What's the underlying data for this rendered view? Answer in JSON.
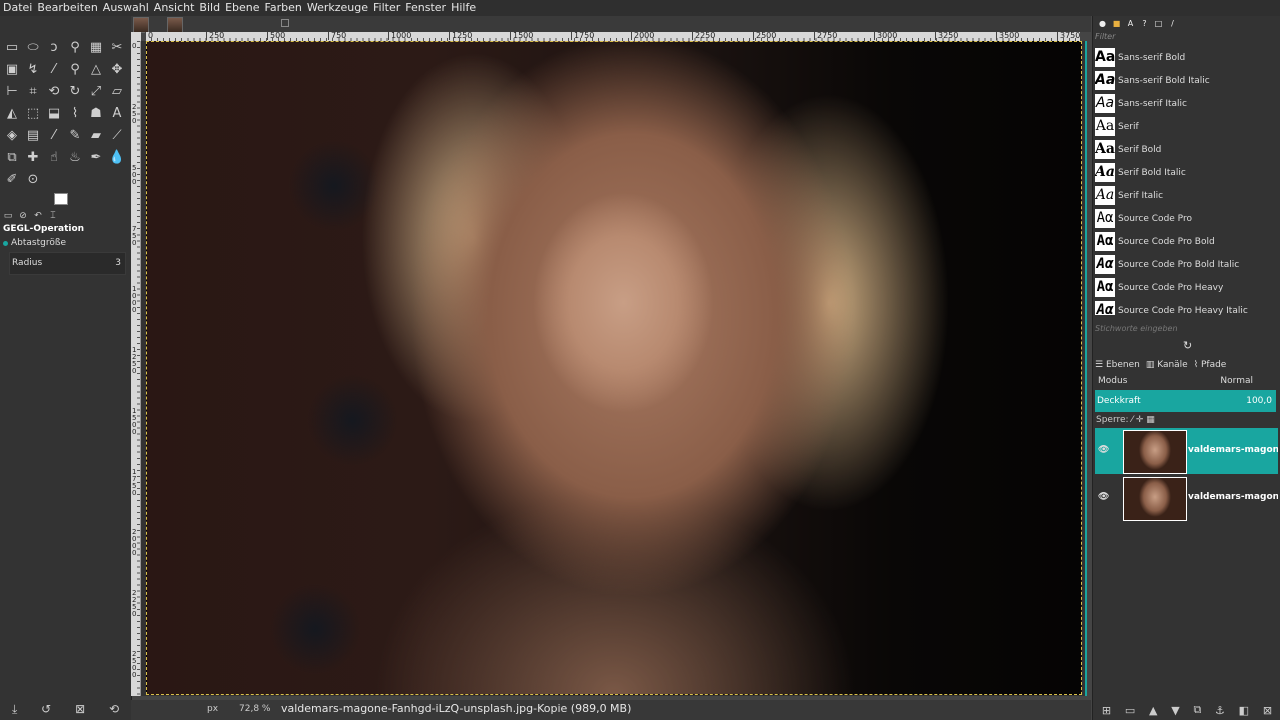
{
  "menu": [
    "Datei",
    "Bearbeiten",
    "Auswahl",
    "Ansicht",
    "Bild",
    "Ebene",
    "Farben",
    "Werkzeuge",
    "Filter",
    "Fenster",
    "Hilfe"
  ],
  "toolbox": {
    "tools": [
      "rect-select",
      "ellipse-select",
      "free-select",
      "fuzzy-select",
      "select-by-color",
      "scissors",
      "foreground-select",
      "paths",
      "color-picker",
      "zoom",
      "measure",
      "move",
      "align",
      "crop",
      "unified-transform",
      "rotate",
      "scale",
      "shear",
      "flip",
      "perspective",
      "3d-transform",
      "warp",
      "cage",
      "text",
      "bucket-fill",
      "gradient",
      "paintbrush",
      "pencil",
      "eraser",
      "airbrush",
      "clone",
      "heal",
      "smudge",
      "dodge",
      "ink",
      "blur",
      "mypaint-brush",
      "handle-transform"
    ],
    "options_title": "GEGL-Operation",
    "sample_size_label": "Abtastgröße",
    "radius_label": "Radius",
    "radius_value": "3"
  },
  "rulers": {
    "horizontal": [
      "0",
      "250",
      "500",
      "750",
      "1000",
      "1250",
      "1500",
      "1750",
      "2000",
      "2250",
      "2500",
      "2750",
      "3000",
      "3250",
      "3500",
      "3750"
    ],
    "vertical": [
      "0",
      "2 5 0",
      "5 0 0",
      "7 5 0",
      "1 0 0 0",
      "1 2 5 0",
      "1 5 0 0",
      "1 7 5 0",
      "2 0 0 0",
      "2 2 5 0",
      "2 5 0 0"
    ]
  },
  "statusbar": {
    "unit": "px",
    "zoom": "72,8 %",
    "title": "valdemars-magone-Fanhgd-iLzQ-unsplash.jpg-Kopie (989,0 MB)"
  },
  "dock": {
    "filter_placeholder": "Filter",
    "fonts": [
      {
        "name": "Sans-serif Bold",
        "preview": "Aa"
      },
      {
        "name": "Sans-serif Bold Italic",
        "preview": "Aa"
      },
      {
        "name": "Sans-serif Italic",
        "preview": "Aa"
      },
      {
        "name": "Serif",
        "preview": "Aa"
      },
      {
        "name": "Serif Bold",
        "preview": "Aa"
      },
      {
        "name": "Serif Bold Italic",
        "preview": "Aa"
      },
      {
        "name": "Serif Italic",
        "preview": "Aa"
      },
      {
        "name": "Source Code Pro",
        "preview": "Aα"
      },
      {
        "name": "Source Code Pro Bold",
        "preview": "Aα"
      },
      {
        "name": "Source Code Pro Bold Italic",
        "preview": "Aα"
      },
      {
        "name": "Source Code Pro Heavy",
        "preview": "Aα"
      },
      {
        "name": "Source Code Pro Heavy Italic",
        "preview": "Aα"
      }
    ],
    "tag_placeholder": "Stichworte eingeben",
    "layer_tabs": [
      "Ebenen",
      "Kanäle",
      "Pfade"
    ],
    "mode_label": "Modus",
    "mode_value": "Normal",
    "opacity_label": "Deckkraft",
    "opacity_value": "100,0",
    "lock_label": "Sperre:",
    "layers": [
      {
        "name": "valdemars-magone-Fanhgd-iLzQ-unsplash.jpg-Kopie",
        "active": true
      },
      {
        "name": "valdemars-magone-Fanhgd-iLzQ-unsplash.jpg",
        "active": false
      }
    ]
  },
  "colors": {
    "accent": "#19a6a0",
    "background": "#454545",
    "panel": "#333333"
  }
}
